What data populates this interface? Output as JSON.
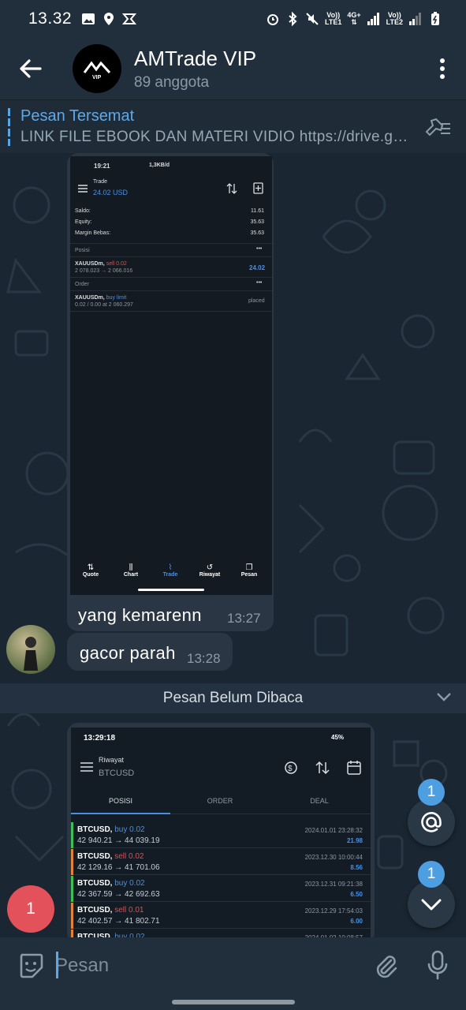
{
  "status_bar": {
    "time": "13.32",
    "net1_top": "Vo))",
    "net1_bottom": "LTE1",
    "net_mid": "4G+",
    "net2_top": "Vo))",
    "net2_bottom": "LTE2"
  },
  "header": {
    "title": "AMTrade VIP",
    "subtitle": "89 anggota",
    "logo_text": "VIP"
  },
  "pinned": {
    "title": "Pesan Tersemat",
    "body": "LINK FILE EBOOK DAN MATERI VIDIO  https://drive.google.com"
  },
  "messages": [
    {
      "text": "yang  kemarenn",
      "time": "13:27"
    },
    {
      "text": "gacor parah",
      "time": "13:28"
    }
  ],
  "shot1": {
    "status_time": "19:21",
    "status_right": "1,3KB/d",
    "title": "Trade",
    "balance": "24.02 USD",
    "summary": [
      {
        "label": "Saldo:",
        "value": "11.61"
      },
      {
        "label": "Equity:",
        "value": "35.63"
      },
      {
        "label": "Margin Bebas:",
        "value": "35.63"
      }
    ],
    "positions_label": "Posisi",
    "position": {
      "symbol": "XAUUSDm,",
      "side": "sell 0.02",
      "prices": "2 078.023 → 2 066.016",
      "pnl": "24.02"
    },
    "orders_label": "Order",
    "order": {
      "symbol": "XAUUSDm,",
      "side": "buy limit",
      "detail": "0.02 / 0.00 at 2 060.297",
      "state": "placed"
    },
    "tabs": [
      "Quote",
      "Chart",
      "Trade",
      "Riwayat",
      "Pesan"
    ]
  },
  "unread_label": "Pesan Belum Dibaca",
  "shot2": {
    "status_time": "13:29:18",
    "status_right": "45%",
    "title": "Riwayat",
    "symbol": "BTCUSD",
    "tabs": [
      "POSISI",
      "ORDER",
      "DEAL"
    ],
    "deals": [
      {
        "symbol": "BTCUSD,",
        "side": "buy 0.02",
        "prices": "42 940.21 → 44 039.19",
        "date": "2024.01.01 23:28:32",
        "profit": "21.98",
        "color": "#3fbf5a"
      },
      {
        "symbol": "BTCUSD,",
        "side": "sell 0.02",
        "prices": "42 129.16 → 41 701.06",
        "date": "2023.12.30 10:00:44",
        "profit": "8.56",
        "color": "#e0823a"
      },
      {
        "symbol": "BTCUSD,",
        "side": "buy 0.02",
        "prices": "42 367.59 → 42 692.63",
        "date": "2023.12.31 09:21:38",
        "profit": "6.50",
        "color": "#3fbf5a"
      },
      {
        "symbol": "BTCUSD,",
        "side": "sell 0.01",
        "prices": "42 402.57 → 41 802.71",
        "date": "2023.12.29 17:54:03",
        "profit": "6.00",
        "color": "#e0823a"
      },
      {
        "symbol": "BTCUSD,",
        "side": "buy 0.02",
        "prices": "",
        "date": "2024.01.02 10:08:57",
        "profit": "",
        "color": "#e0823a"
      }
    ]
  },
  "badges": {
    "mentions": "1",
    "scroll_down": "1",
    "unread": "1"
  },
  "composer": {
    "placeholder": "Pesan"
  },
  "colors": {
    "accent": "#5ea8e8",
    "bubble": "#2a3644",
    "red": "#e3525a",
    "buy": "#4a90e2",
    "sell": "#e05050"
  }
}
